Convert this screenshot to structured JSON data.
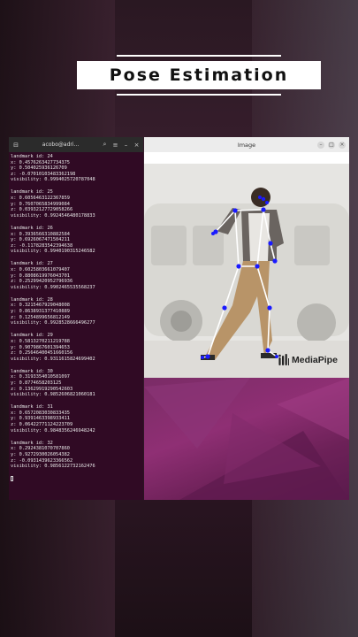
{
  "header": {
    "title_part1": "Pose",
    "title_part2": "Estimation"
  },
  "terminal": {
    "title": "acobo@adri...",
    "entries": [
      {
        "label": "landmark id: 24",
        "x": "x: 0.4576263427734375",
        "y": "y: 0.504025936126709",
        "z": "z: -0.07010103483362198",
        "vis": "visibility: 0.9994025720787048"
      },
      {
        "label": "landmark id: 25",
        "x": "x: 0.6056463122367859",
        "y": "y: 0.7607065834999084",
        "z": "z: 0.03932127729058266",
        "vis": "visibility: 0.9924546480178833"
      },
      {
        "label": "landmark id: 26",
        "x": "x: 0.3936566310882584",
        "y": "y: 0.6926067471504211",
        "z": "z: -0.1178283542394638",
        "vis": "visibility: 0.9940190315246582"
      },
      {
        "label": "landmark id: 27",
        "x": "x: 0.6025803661079407",
        "y": "y: 0.8808619976043701",
        "z": "z: 0.25299420952796936",
        "vis": "visibility: 0.9902465535568237"
      },
      {
        "label": "landmark id: 28",
        "x": "x: 0.3215467929048008",
        "y": "y: 0.8638931377410889",
        "z": "z: 0.1254899656812149",
        "vis": "visibility: 0.9928528666496277"
      },
      {
        "label": "landmark id: 29",
        "x": "x: 0.5813270211219788",
        "y": "y: 0.9079867601394653",
        "z": "z: 0.25646400451660156",
        "vis": "visibility: 0.9311615824699402"
      },
      {
        "label": "landmark id: 30",
        "x": "x: 0.3193354010581097",
        "y": "y: 0.8774658203125",
        "z": "z: 0.13629919290542603",
        "vis": "visibility: 0.9852606821060181"
      },
      {
        "label": "landmark id: 31",
        "x": "x: 0.6572083030833435",
        "y": "y: 0.9391463398933411",
        "z": "z: 0.06422771124223709",
        "vis": "visibility: 0.9848356246948242"
      },
      {
        "label": "landmark id: 32",
        "x": "x: 0.2924381070707860",
        "y": "y: 0.9272930026054382",
        "z": "z: -0.0931439623366562",
        "vis": "visibility: 0.9856122732162476"
      }
    ]
  },
  "image_window": {
    "title": "Image",
    "logo_text": "MediaPipe"
  },
  "colors": {
    "terminal_bg": "#300a24",
    "landmark": "#1a1aff",
    "skeleton": "#ffffff",
    "wallpaper": "#7a2c66"
  },
  "icons": [
    "terminal-icon",
    "search-icon",
    "menu-icon",
    "minimize-icon",
    "maximize-icon",
    "close-icon",
    "mediapipe-logo-icon"
  ]
}
